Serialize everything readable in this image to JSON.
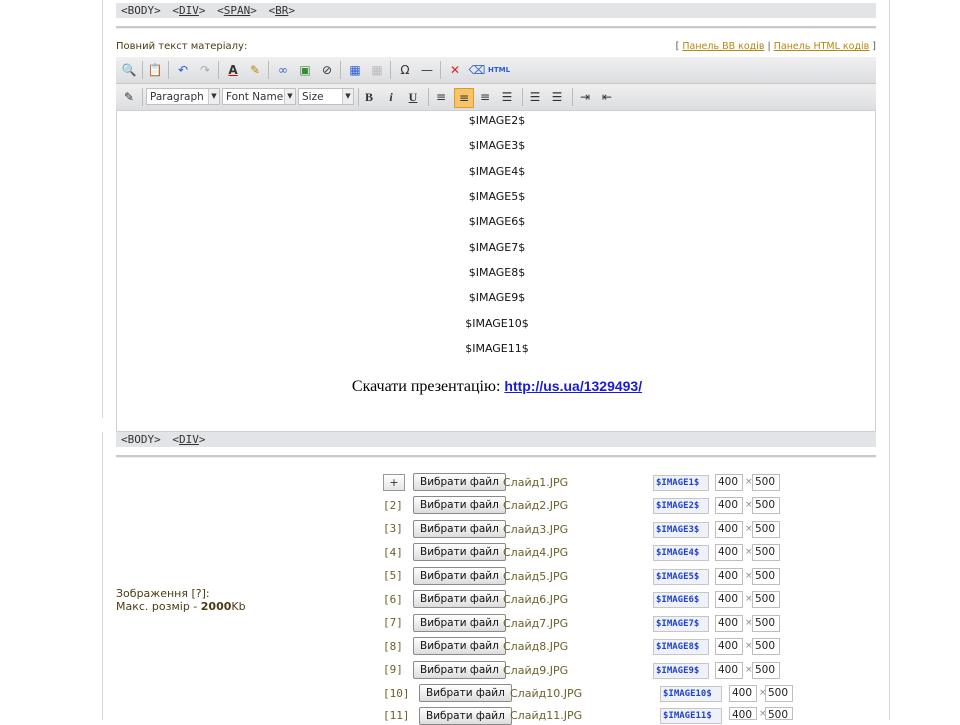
{
  "top_path": [
    "BODY",
    "DIV",
    "SPAN",
    "BR"
  ],
  "bottom_path": [
    "BODY",
    "DIV"
  ],
  "full_text_label": "Повний текст матеріалу:",
  "panels": {
    "bb": "Панель BB кодів",
    "html": "Панель HTML кодів"
  },
  "toolbar_formats": {
    "paragraph": "Paragraph",
    "font": "Font Name",
    "size": "Size"
  },
  "editor_lines": [
    "$IMAGE2$",
    "$IMAGE3$",
    "$IMAGE4$",
    "$IMAGE5$",
    "$IMAGE6$",
    "$IMAGE7$",
    "$IMAGE8$",
    "$IMAGE9$",
    "$IMAGE10$",
    "$IMAGE11$"
  ],
  "download_text": "Скачати презентацію:",
  "download_link": "http://us.ua/1329493/",
  "images_label": "Зображення [?]:",
  "max_size_prefix": "Макс. розмір - ",
  "max_size_value": "2000",
  "max_size_unit": "Kb",
  "add_label": "+",
  "choose_label": "Вибрати файл",
  "rows": [
    {
      "num": "",
      "file": "Слайд1.JPG",
      "code": "$IMAGE1$",
      "w": "400",
      "h": "500"
    },
    {
      "num": "[2]",
      "file": "Слайд2.JPG",
      "code": "$IMAGE2$",
      "w": "400",
      "h": "500"
    },
    {
      "num": "[3]",
      "file": "Слайд3.JPG",
      "code": "$IMAGE3$",
      "w": "400",
      "h": "500"
    },
    {
      "num": "[4]",
      "file": "Слайд4.JPG",
      "code": "$IMAGE4$",
      "w": "400",
      "h": "500"
    },
    {
      "num": "[5]",
      "file": "Слайд5.JPG",
      "code": "$IMAGE5$",
      "w": "400",
      "h": "500"
    },
    {
      "num": "[6]",
      "file": "Слайд6.JPG",
      "code": "$IMAGE6$",
      "w": "400",
      "h": "500"
    },
    {
      "num": "[7]",
      "file": "Слайд7.JPG",
      "code": "$IMAGE7$",
      "w": "400",
      "h": "500"
    },
    {
      "num": "[8]",
      "file": "Слайд8.JPG",
      "code": "$IMAGE8$",
      "w": "400",
      "h": "500"
    },
    {
      "num": "[9]",
      "file": "Слайд9.JPG",
      "code": "$IMAGE9$",
      "w": "400",
      "h": "500"
    },
    {
      "num": "[10]",
      "file": "Слайд10.JPG",
      "code": "$IMAGE10$",
      "w": "400",
      "h": "500"
    },
    {
      "num": "[11]",
      "file": "Слайд11.JPG",
      "code": "$IMAGE11$",
      "w": "400",
      "h": "500"
    }
  ]
}
